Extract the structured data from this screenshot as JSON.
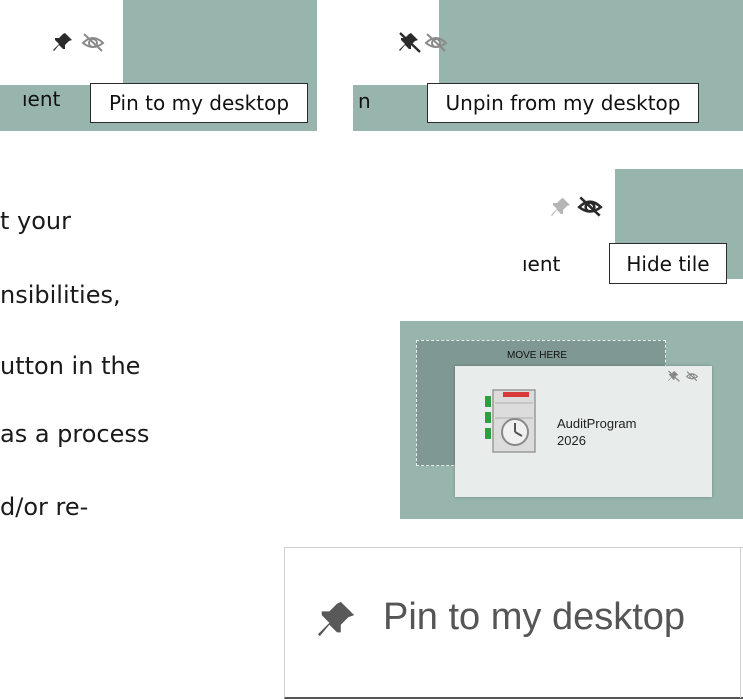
{
  "panel_pin": {
    "fragment": "ıent",
    "tooltip": "Pin to my desktop"
  },
  "panel_unpin": {
    "fragment": "n",
    "tooltip": "Unpin from my desktop"
  },
  "panel_hide": {
    "fragment": "ıent",
    "tooltip": "Hide tile"
  },
  "panel_move": {
    "dropzone_label": "MOVE HERE",
    "tile_name": "AuditProgram",
    "tile_year": "2026"
  },
  "body_lines": [
    "t your",
    "nsibilities,",
    "utton in the",
    "as a process",
    "d/or re-"
  ],
  "big_button": {
    "label": "Pin to my desktop"
  },
  "colors": {
    "panel": "#97b4ad",
    "dropzone": "#7f9893",
    "tile": "#e8eceb"
  },
  "icons": [
    "pin-icon",
    "hide-icon",
    "unpin-icon",
    "audit-program-icon"
  ]
}
